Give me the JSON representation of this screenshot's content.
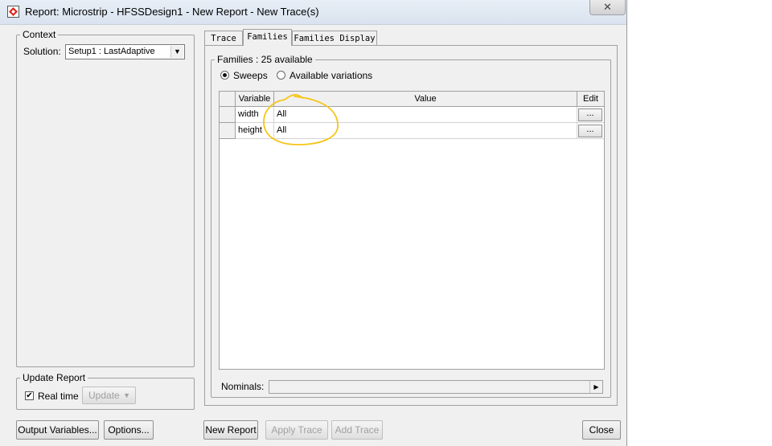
{
  "window": {
    "title": "Report: Microstrip - HFSSDesign1 - New Report - New Trace(s)"
  },
  "context": {
    "legend": "Context",
    "solution_label": "Solution:",
    "solution_value": "Setup1 : LastAdaptive"
  },
  "update_report": {
    "legend": "Update Report",
    "realtime_label": "Real time",
    "realtime_checked": true,
    "update_label": "Update"
  },
  "tabs": [
    {
      "label": "Trace",
      "active": false
    },
    {
      "label": "Families",
      "active": true
    },
    {
      "label": "Families Display",
      "active": false
    }
  ],
  "families": {
    "legend": "Families : 25 available",
    "radio_sweeps": "Sweeps",
    "radio_variations": "Available variations",
    "selected": "Sweeps",
    "columns": {
      "variable": "Variable",
      "value": "Value",
      "edit": "Edit"
    },
    "rows": [
      {
        "variable": "width",
        "value": "All",
        "edit": "..."
      },
      {
        "variable": "height",
        "value": "All",
        "edit": "..."
      }
    ],
    "nominals_label": "Nominals:"
  },
  "buttons": {
    "output_variables": "Output Variables...",
    "options": "Options...",
    "new_report": "New Report",
    "apply_trace": "Apply Trace",
    "add_trace": "Add Trace",
    "close": "Close"
  },
  "annotation_color": "#f5c518"
}
